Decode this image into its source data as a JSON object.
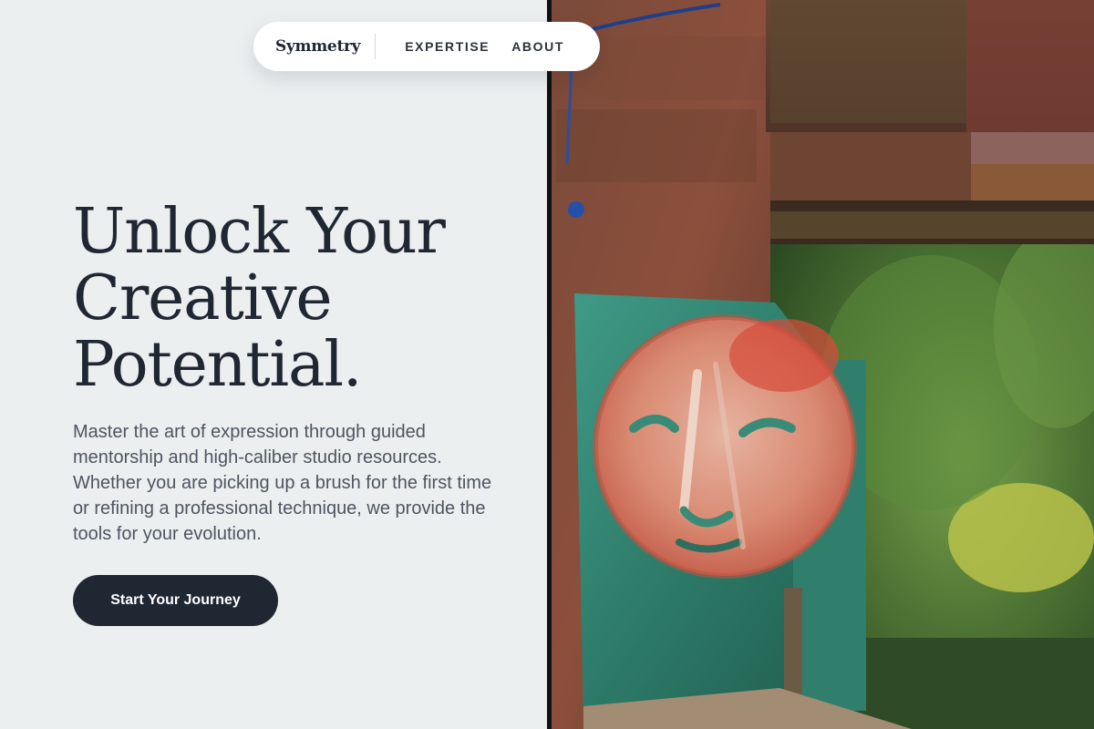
{
  "nav": {
    "brand": "Symmetry",
    "links": [
      "EXPERTISE",
      "ABOUT"
    ]
  },
  "hero": {
    "title_lines": [
      "Unlock Your",
      "Creative",
      "Potential."
    ],
    "description": "Master the art of expression through guided mentorship and high-caliber studio resources. Whether you are picking up a brush for the first time or refining a professional technique, we provide the tools for your evolution.",
    "cta_label": "Start Your Journey"
  },
  "colors": {
    "background": "#ebeff0",
    "text_dark": "#1f2733",
    "text_muted": "#4d5561",
    "button_bg": "#1f2733",
    "button_text": "#ffffff"
  }
}
